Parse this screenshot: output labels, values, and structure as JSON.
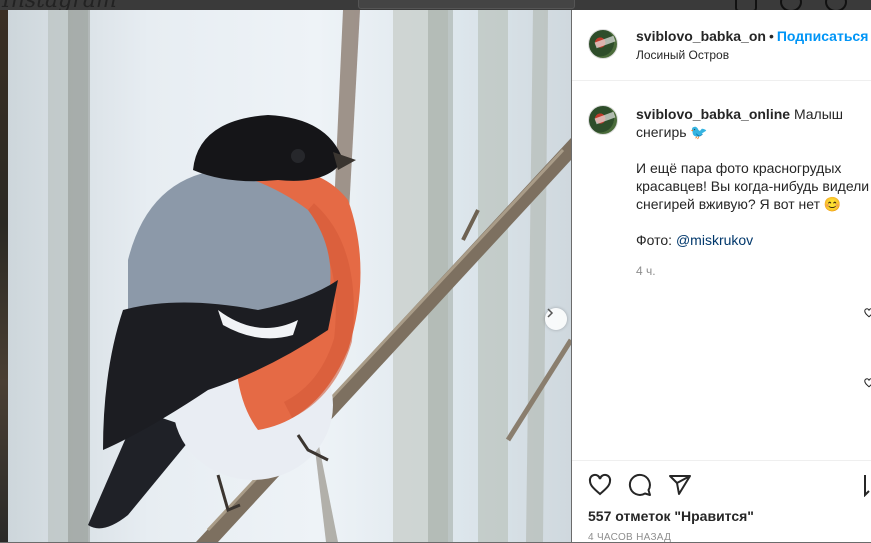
{
  "app": {
    "logo": "Instagram"
  },
  "post": {
    "author": "sviblovo_babka_on",
    "author_full": "sviblovo_babka_online",
    "separator": "•",
    "follow_label": "Подписаться",
    "location": "Лосиный Остров",
    "caption_first": "Малыш снегирь 🐦",
    "caption_second": "И ещё пара фото красногрудых красавцев! Вы когда-нибудь видели снегирей вживую? Я вот нет 😊",
    "photo_credit_label": "Фото:",
    "photo_credit_mention": "@miskrukov",
    "caption_time": "4 ч.",
    "likes_label": "557 отметок \"Нравится\"",
    "time_ago": "4 ЧАСОВ НАЗАД"
  },
  "icons": {
    "like": "heart-icon",
    "comment": "comment-icon",
    "share": "share-icon",
    "save": "bookmark-icon",
    "carousel_next": "chevron-right-icon"
  },
  "colors": {
    "follow": "#0095f6",
    "mention": "#00376b",
    "text": "#262626",
    "muted": "#8e8e8e"
  }
}
